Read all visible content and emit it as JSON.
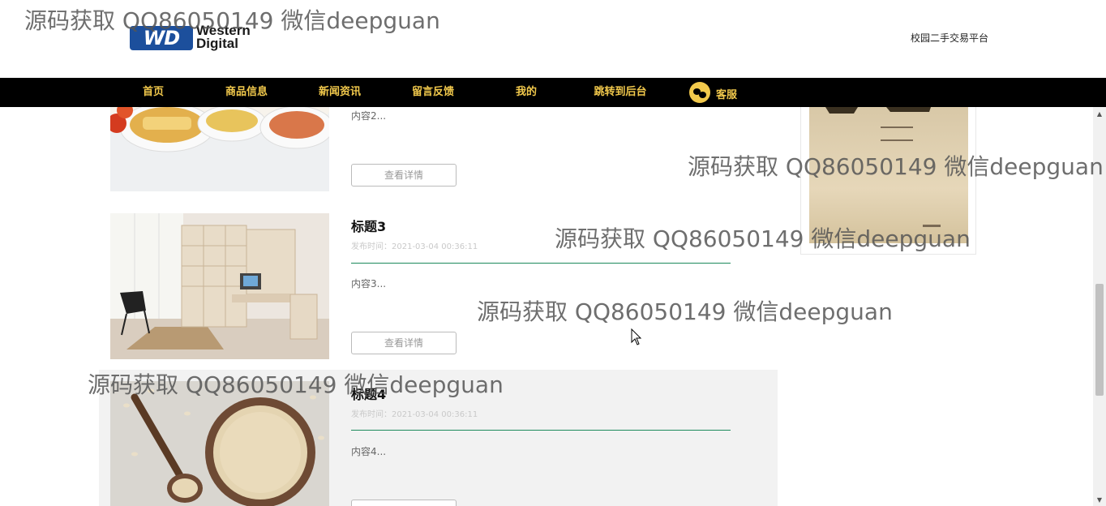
{
  "header": {
    "logo_mark": "WD",
    "logo_line1": "Western",
    "logo_line2": "Digital",
    "platform_title": "校园二手交易平台"
  },
  "nav": {
    "items": [
      "首页",
      "商品信息",
      "新闻资讯",
      "留言反馈",
      "我的",
      "跳转到后台"
    ],
    "customer_service": "客服"
  },
  "news": [
    {
      "title": "",
      "date": "",
      "content": "内容2...",
      "button": "查看详情"
    },
    {
      "title": "标题3",
      "date": "发布时间：2021-03-04 00:36:11",
      "content": "内容3...",
      "button": "查看详情"
    },
    {
      "title": "标题4",
      "date": "发布时间：2021-03-04 00:36:11",
      "content": "内容4...",
      "button": ""
    }
  ],
  "watermark": "源码获取 QQ86050149 微信deepguan",
  "colors": {
    "nav_bg": "#000000",
    "nav_text": "#f2c94c",
    "accent_rule": "#1d8a5c",
    "hover_bg": "#f2f2f2",
    "logo_blue": "#1c4f9c"
  },
  "icons": [
    "wechat-icon",
    "mouse-cursor-icon",
    "scroll-up-arrow-icon",
    "scroll-down-arrow-icon"
  ]
}
